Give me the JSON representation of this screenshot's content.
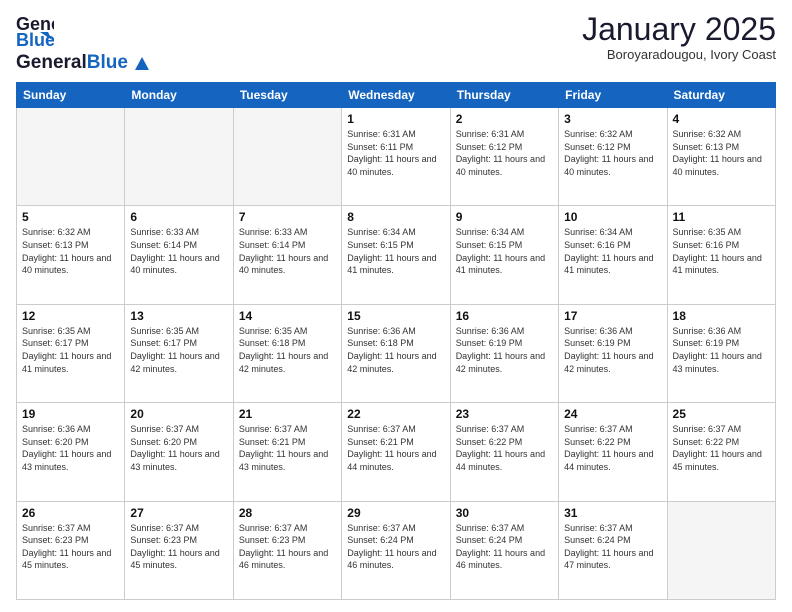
{
  "header": {
    "logo_general": "General",
    "logo_blue": "Blue",
    "month_title": "January 2025",
    "subtitle": "Boroyaradougou, Ivory Coast"
  },
  "weekdays": [
    "Sunday",
    "Monday",
    "Tuesday",
    "Wednesday",
    "Thursday",
    "Friday",
    "Saturday"
  ],
  "weeks": [
    [
      {
        "day": "",
        "info": ""
      },
      {
        "day": "",
        "info": ""
      },
      {
        "day": "",
        "info": ""
      },
      {
        "day": "1",
        "info": "Sunrise: 6:31 AM\nSunset: 6:11 PM\nDaylight: 11 hours\nand 40 minutes."
      },
      {
        "day": "2",
        "info": "Sunrise: 6:31 AM\nSunset: 6:12 PM\nDaylight: 11 hours\nand 40 minutes."
      },
      {
        "day": "3",
        "info": "Sunrise: 6:32 AM\nSunset: 6:12 PM\nDaylight: 11 hours\nand 40 minutes."
      },
      {
        "day": "4",
        "info": "Sunrise: 6:32 AM\nSunset: 6:13 PM\nDaylight: 11 hours\nand 40 minutes."
      }
    ],
    [
      {
        "day": "5",
        "info": "Sunrise: 6:32 AM\nSunset: 6:13 PM\nDaylight: 11 hours\nand 40 minutes."
      },
      {
        "day": "6",
        "info": "Sunrise: 6:33 AM\nSunset: 6:14 PM\nDaylight: 11 hours\nand 40 minutes."
      },
      {
        "day": "7",
        "info": "Sunrise: 6:33 AM\nSunset: 6:14 PM\nDaylight: 11 hours\nand 40 minutes."
      },
      {
        "day": "8",
        "info": "Sunrise: 6:34 AM\nSunset: 6:15 PM\nDaylight: 11 hours\nand 41 minutes."
      },
      {
        "day": "9",
        "info": "Sunrise: 6:34 AM\nSunset: 6:15 PM\nDaylight: 11 hours\nand 41 minutes."
      },
      {
        "day": "10",
        "info": "Sunrise: 6:34 AM\nSunset: 6:16 PM\nDaylight: 11 hours\nand 41 minutes."
      },
      {
        "day": "11",
        "info": "Sunrise: 6:35 AM\nSunset: 6:16 PM\nDaylight: 11 hours\nand 41 minutes."
      }
    ],
    [
      {
        "day": "12",
        "info": "Sunrise: 6:35 AM\nSunset: 6:17 PM\nDaylight: 11 hours\nand 41 minutes."
      },
      {
        "day": "13",
        "info": "Sunrise: 6:35 AM\nSunset: 6:17 PM\nDaylight: 11 hours\nand 42 minutes."
      },
      {
        "day": "14",
        "info": "Sunrise: 6:35 AM\nSunset: 6:18 PM\nDaylight: 11 hours\nand 42 minutes."
      },
      {
        "day": "15",
        "info": "Sunrise: 6:36 AM\nSunset: 6:18 PM\nDaylight: 11 hours\nand 42 minutes."
      },
      {
        "day": "16",
        "info": "Sunrise: 6:36 AM\nSunset: 6:19 PM\nDaylight: 11 hours\nand 42 minutes."
      },
      {
        "day": "17",
        "info": "Sunrise: 6:36 AM\nSunset: 6:19 PM\nDaylight: 11 hours\nand 42 minutes."
      },
      {
        "day": "18",
        "info": "Sunrise: 6:36 AM\nSunset: 6:19 PM\nDaylight: 11 hours\nand 43 minutes."
      }
    ],
    [
      {
        "day": "19",
        "info": "Sunrise: 6:36 AM\nSunset: 6:20 PM\nDaylight: 11 hours\nand 43 minutes."
      },
      {
        "day": "20",
        "info": "Sunrise: 6:37 AM\nSunset: 6:20 PM\nDaylight: 11 hours\nand 43 minutes."
      },
      {
        "day": "21",
        "info": "Sunrise: 6:37 AM\nSunset: 6:21 PM\nDaylight: 11 hours\nand 43 minutes."
      },
      {
        "day": "22",
        "info": "Sunrise: 6:37 AM\nSunset: 6:21 PM\nDaylight: 11 hours\nand 44 minutes."
      },
      {
        "day": "23",
        "info": "Sunrise: 6:37 AM\nSunset: 6:22 PM\nDaylight: 11 hours\nand 44 minutes."
      },
      {
        "day": "24",
        "info": "Sunrise: 6:37 AM\nSunset: 6:22 PM\nDaylight: 11 hours\nand 44 minutes."
      },
      {
        "day": "25",
        "info": "Sunrise: 6:37 AM\nSunset: 6:22 PM\nDaylight: 11 hours\nand 45 minutes."
      }
    ],
    [
      {
        "day": "26",
        "info": "Sunrise: 6:37 AM\nSunset: 6:23 PM\nDaylight: 11 hours\nand 45 minutes."
      },
      {
        "day": "27",
        "info": "Sunrise: 6:37 AM\nSunset: 6:23 PM\nDaylight: 11 hours\nand 45 minutes."
      },
      {
        "day": "28",
        "info": "Sunrise: 6:37 AM\nSunset: 6:23 PM\nDaylight: 11 hours\nand 46 minutes."
      },
      {
        "day": "29",
        "info": "Sunrise: 6:37 AM\nSunset: 6:24 PM\nDaylight: 11 hours\nand 46 minutes."
      },
      {
        "day": "30",
        "info": "Sunrise: 6:37 AM\nSunset: 6:24 PM\nDaylight: 11 hours\nand 46 minutes."
      },
      {
        "day": "31",
        "info": "Sunrise: 6:37 AM\nSunset: 6:24 PM\nDaylight: 11 hours\nand 47 minutes."
      },
      {
        "day": "",
        "info": ""
      }
    ]
  ]
}
